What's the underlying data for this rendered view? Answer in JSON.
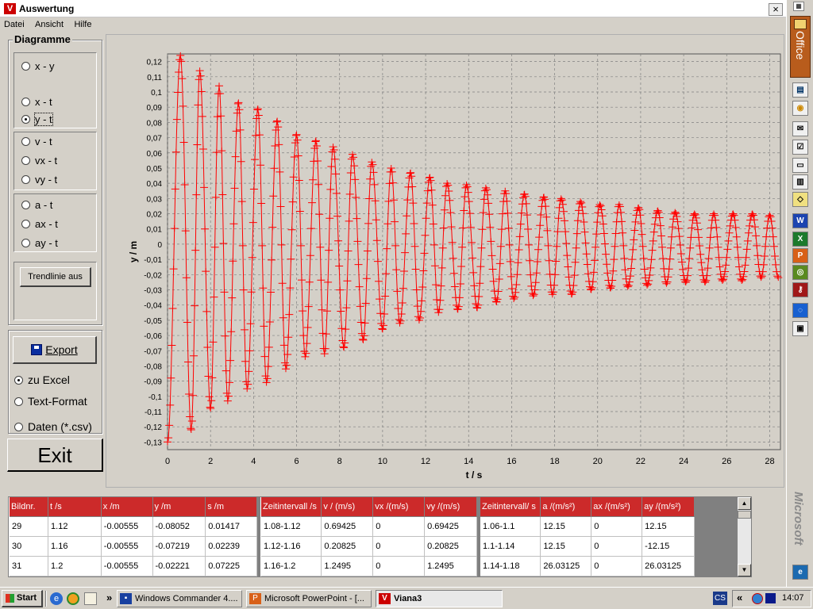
{
  "window": {
    "title": "Auswertung",
    "icon_letter": "V",
    "close_label": "×"
  },
  "menu": [
    "Datei",
    "Ansicht",
    "Hilfe"
  ],
  "diagramme": {
    "title": "Diagramme",
    "options": [
      {
        "label": "x - y",
        "selected": false
      },
      {
        "label": "x - t",
        "selected": false
      },
      {
        "label": "y - t",
        "selected": true
      },
      {
        "label": "v - t",
        "selected": false
      },
      {
        "label": "vx - t",
        "selected": false
      },
      {
        "label": "vy - t",
        "selected": false
      },
      {
        "label": "a - t",
        "selected": false
      },
      {
        "label": "ax - t",
        "selected": false
      },
      {
        "label": "ay - t",
        "selected": false
      }
    ],
    "trend_button": "Trendlinie aus"
  },
  "export": {
    "button": "Export",
    "options": [
      {
        "label": "zu Excel",
        "selected": true
      },
      {
        "label": "Text-Format",
        "selected": false
      },
      {
        "label": "Daten (*.csv)",
        "selected": false
      }
    ]
  },
  "exit_button": "Exit",
  "chart_data": {
    "type": "line",
    "xlabel": "t / s",
    "ylabel": "y / m",
    "xlim": [
      0,
      28.5
    ],
    "ylim": [
      -0.135,
      0.125
    ],
    "xticks": [
      "0",
      "2",
      "4",
      "6",
      "8",
      "10",
      "12",
      "14",
      "16",
      "18",
      "20",
      "22",
      "24",
      "26",
      "28"
    ],
    "yticks": [
      "0,12",
      "0,11",
      "0,1",
      "0,09",
      "0,08",
      "0,07",
      "0,06",
      "0,05",
      "0,04",
      "0,03",
      "0,02",
      "0,01",
      "0",
      "-0,01",
      "-0,02",
      "-0,03",
      "-0,04",
      "-0,05",
      "-0,06",
      "-0,07",
      "-0,08",
      "-0,09",
      "-0,1",
      "-0,11",
      "-0,12",
      "-0,13"
    ],
    "grid": true,
    "series": [
      {
        "color": "#ff0000",
        "marker": "plus",
        "sample_interval_s": 0.04,
        "peaks": [
          {
            "t": 0.0,
            "y": -0.13
          },
          {
            "t": 0.6,
            "y": 0.124
          },
          {
            "t": 1.1,
            "y": -0.122
          },
          {
            "t": 1.5,
            "y": 0.114
          },
          {
            "t": 2.0,
            "y": -0.108
          },
          {
            "t": 2.4,
            "y": 0.104
          },
          {
            "t": 2.8,
            "y": -0.103
          },
          {
            "t": 3.3,
            "y": 0.093
          },
          {
            "t": 3.7,
            "y": -0.095
          },
          {
            "t": 4.2,
            "y": 0.089
          },
          {
            "t": 4.6,
            "y": -0.091
          },
          {
            "t": 5.1,
            "y": 0.081
          },
          {
            "t": 5.5,
            "y": -0.082
          },
          {
            "t": 6.0,
            "y": 0.072
          },
          {
            "t": 6.4,
            "y": -0.074
          },
          {
            "t": 6.9,
            "y": 0.068
          },
          {
            "t": 7.3,
            "y": -0.072
          },
          {
            "t": 7.7,
            "y": 0.064
          },
          {
            "t": 8.2,
            "y": -0.068
          },
          {
            "t": 8.6,
            "y": 0.059
          },
          {
            "t": 9.1,
            "y": -0.063
          },
          {
            "t": 9.5,
            "y": 0.054
          },
          {
            "t": 10.0,
            "y": -0.056
          },
          {
            "t": 10.4,
            "y": 0.05
          },
          {
            "t": 10.8,
            "y": -0.052
          },
          {
            "t": 11.3,
            "y": 0.047
          },
          {
            "t": 11.7,
            "y": -0.05
          },
          {
            "t": 12.2,
            "y": 0.044
          },
          {
            "t": 12.6,
            "y": -0.045
          },
          {
            "t": 13.0,
            "y": 0.04
          },
          {
            "t": 13.5,
            "y": -0.043
          },
          {
            "t": 13.9,
            "y": 0.039
          },
          {
            "t": 14.4,
            "y": -0.042
          },
          {
            "t": 14.8,
            "y": 0.037
          },
          {
            "t": 15.3,
            "y": -0.038
          },
          {
            "t": 15.7,
            "y": 0.035
          },
          {
            "t": 16.1,
            "y": -0.036
          },
          {
            "t": 16.6,
            "y": 0.033
          },
          {
            "t": 17.0,
            "y": -0.034
          },
          {
            "t": 17.5,
            "y": 0.031
          },
          {
            "t": 17.9,
            "y": -0.033
          },
          {
            "t": 18.3,
            "y": 0.03
          },
          {
            "t": 18.8,
            "y": -0.033
          },
          {
            "t": 19.2,
            "y": 0.028
          },
          {
            "t": 19.7,
            "y": -0.03
          },
          {
            "t": 20.1,
            "y": 0.026
          },
          {
            "t": 20.6,
            "y": -0.029
          },
          {
            "t": 21.0,
            "y": 0.026
          },
          {
            "t": 21.4,
            "y": -0.028
          },
          {
            "t": 21.9,
            "y": 0.024
          },
          {
            "t": 22.3,
            "y": -0.027
          },
          {
            "t": 22.8,
            "y": 0.022
          },
          {
            "t": 23.2,
            "y": -0.026
          },
          {
            "t": 23.6,
            "y": 0.021
          },
          {
            "t": 24.1,
            "y": -0.025
          },
          {
            "t": 24.5,
            "y": 0.02
          },
          {
            "t": 25.0,
            "y": -0.025
          },
          {
            "t": 25.4,
            "y": 0.02
          },
          {
            "t": 25.8,
            "y": -0.024
          },
          {
            "t": 26.3,
            "y": 0.02
          },
          {
            "t": 26.7,
            "y": -0.024
          },
          {
            "t": 27.2,
            "y": 0.02
          },
          {
            "t": 27.6,
            "y": -0.022
          },
          {
            "t": 28.0,
            "y": 0.019
          },
          {
            "t": 28.4,
            "y": -0.022
          }
        ]
      }
    ]
  },
  "table": {
    "group1": {
      "headers": [
        "Bildnr.",
        "t /s",
        "x /m",
        "y /m",
        "s /m"
      ],
      "rows": [
        [
          "29",
          "1.12",
          "-0.00555",
          "-0.08052",
          "0.01417"
        ],
        [
          "30",
          "1.16",
          "-0.00555",
          "-0.07219",
          "0.02239"
        ],
        [
          "31",
          "1.2",
          "-0.00555",
          "-0.02221",
          "0.07225"
        ]
      ]
    },
    "group2": {
      "headers": [
        "Zeitintervall /s",
        "v / (m/s)",
        "vx /(m/s)",
        "vy /(m/s)"
      ],
      "rows": [
        [
          "1.08-1.12",
          "0.69425",
          "0",
          "0.69425"
        ],
        [
          "1.12-1.16",
          "0.20825",
          "0",
          "0.20825"
        ],
        [
          "1.16-1.2",
          "1.2495",
          "0",
          "1.2495"
        ]
      ]
    },
    "group3": {
      "headers": [
        "Zeitintervall/ s",
        "a /(m/s²)",
        "ax /(m/s²)",
        "ay /(m/s²)"
      ],
      "rows": [
        [
          "1.06-1.1",
          "12.15",
          "0",
          "12.15"
        ],
        [
          "1.1-1.14",
          "12.15",
          "0",
          "-12.15"
        ],
        [
          "1.14-1.18",
          "26.03125",
          "0",
          "26.03125"
        ]
      ]
    }
  },
  "office_bar": {
    "label": "Office",
    "brand": "Microsoft"
  },
  "taskbar": {
    "start": "Start",
    "tasks": [
      "Windows Commander 4....",
      "Microsoft PowerPoint - [...",
      "Viana3"
    ],
    "lang": "CS",
    "clock": "14:07",
    "chevron_left": "»",
    "chevron_tray": "«"
  },
  "colors": {
    "plot_line": "#ff0000",
    "header_bg": "#cc2a2a",
    "desktop": "#d4d0c8"
  }
}
